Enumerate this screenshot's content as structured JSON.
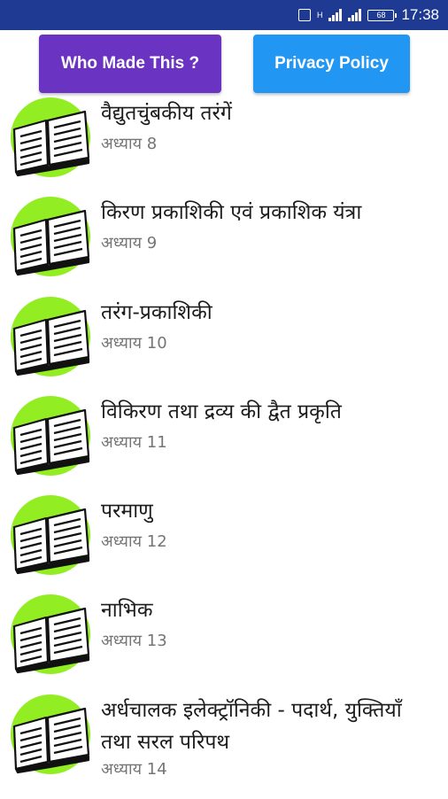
{
  "status_bar": {
    "time": "17:38",
    "battery": "68",
    "network": "H"
  },
  "buttons": {
    "who_made": "Who Made This ?",
    "privacy_policy": "Privacy Policy"
  },
  "colors": {
    "status_bar": "#1f3a93",
    "who_button": "#6a33c2",
    "privacy_button": "#2196f3",
    "icon_circle": "#92ee22"
  },
  "chapters": [
    {
      "title": "वैद्युतचुंबकीय तरंगें",
      "subtitle": "अध्याय 8",
      "icon": "open-book-icon"
    },
    {
      "title": "किरण प्रकाशिकी एवं प्रकाशिक यंत्रा",
      "subtitle": "अध्याय 9",
      "icon": "open-book-icon"
    },
    {
      "title": "तरंग-प्रकाशिकी",
      "subtitle": "अध्याय 10",
      "icon": "open-book-icon"
    },
    {
      "title": "विकिरण तथा द्रव्य की द्वैत प्रकृति",
      "subtitle": "अध्याय 11",
      "icon": "open-book-icon"
    },
    {
      "title": "परमाणु",
      "subtitle": "अध्याय 12",
      "icon": "open-book-icon"
    },
    {
      "title": "नाभिक",
      "subtitle": "अध्याय 13",
      "icon": "open-book-icon"
    },
    {
      "title": "अर्धचालक इलेक्ट्रॉनिकी - पदार्थ, युक्तियाँ तथा सरल परिपथ",
      "subtitle": "अध्याय 14",
      "icon": "open-book-icon"
    }
  ]
}
